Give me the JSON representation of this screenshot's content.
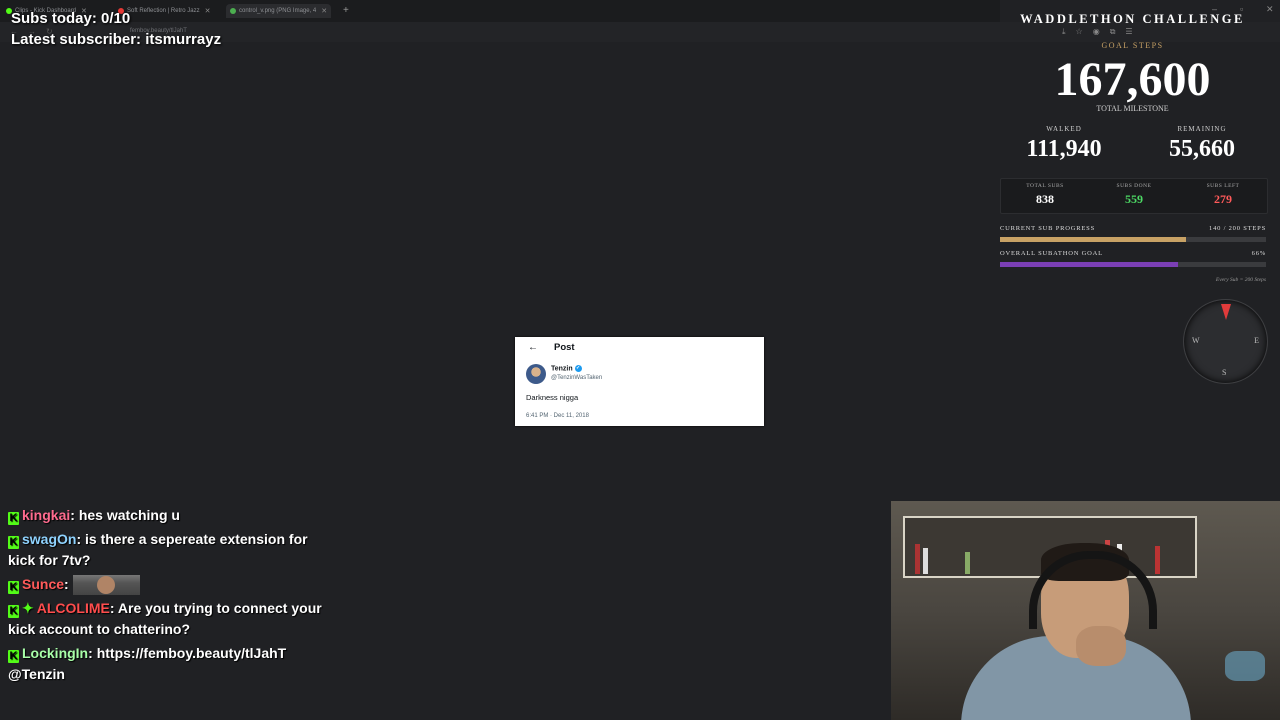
{
  "browser": {
    "tabs": [
      {
        "label": "Clips - Kick Dashboard",
        "color": "#53fc18"
      },
      {
        "label": "Soft Reflection | Retro Jazz",
        "color": "#e53935"
      },
      {
        "label": "control_v.png (PNG Image, 4",
        "color": "#4caf50",
        "active": true
      }
    ],
    "new_tab": "+",
    "url": "femboy.beauty/tlJahT"
  },
  "overlay": {
    "subs_today": "Subs today: 0/10",
    "latest_subscriber": "Latest subscriber: itsmurrayz"
  },
  "tweet": {
    "header": "Post",
    "back": "←",
    "name": "Tenzin",
    "handle": "@TenzinWasTaken",
    "text": "Darkness nigga",
    "timestamp": "6:41 PM · Dec 11, 2018"
  },
  "challenge": {
    "title": "WADDLETHON CHALLENGE",
    "goal_label": "GOAL STEPS",
    "goal_value": "167,600",
    "milestone_label": "TOTAL MILESTONE",
    "walked_label": "WALKED",
    "walked_value": "111,940",
    "remaining_label": "REMAINING",
    "remaining_value": "55,660",
    "stats": [
      {
        "label": "TOTAL SUBS",
        "value": "838",
        "color": "#ffffff"
      },
      {
        "label": "SUBS DONE",
        "value": "559",
        "color": "#4cd964"
      },
      {
        "label": "SUBS LEFT",
        "value": "279",
        "color": "#ff5a5a"
      }
    ],
    "current_label": "CURRENT SUB PROGRESS",
    "current_value": "140 / 200 STEPS",
    "current_fraction": 0.7,
    "current_color": "#c8a265",
    "overall_label": "OVERALL SUBATHON GOAL",
    "overall_value": "66%",
    "overall_fraction": 0.67,
    "overall_color": "#7b3fb5",
    "note": "Every Sub = 200 Steps",
    "compass": {
      "n": "",
      "e": "E",
      "s": "S",
      "w": "W"
    }
  },
  "chat": [
    {
      "user": "kingkai",
      "color": "#ff6b8f",
      "text": "hes watching u"
    },
    {
      "user": "swagOn",
      "color": "#8fd3ff",
      "text": "is there a sepereate extension for kick for 7tv?"
    },
    {
      "user": "Sunce",
      "color": "#ff5a5a",
      "text": "",
      "emote": true
    },
    {
      "user": "ALCOLIME",
      "color": "#ff4d4d",
      "text": "Are you trying to connect your kick account to chatterino?",
      "sparkle": true
    },
    {
      "user": "LockingIn",
      "color": "#a8ffa8",
      "text": "https://femboy.beauty/tlJahT @Tenzin"
    }
  ]
}
